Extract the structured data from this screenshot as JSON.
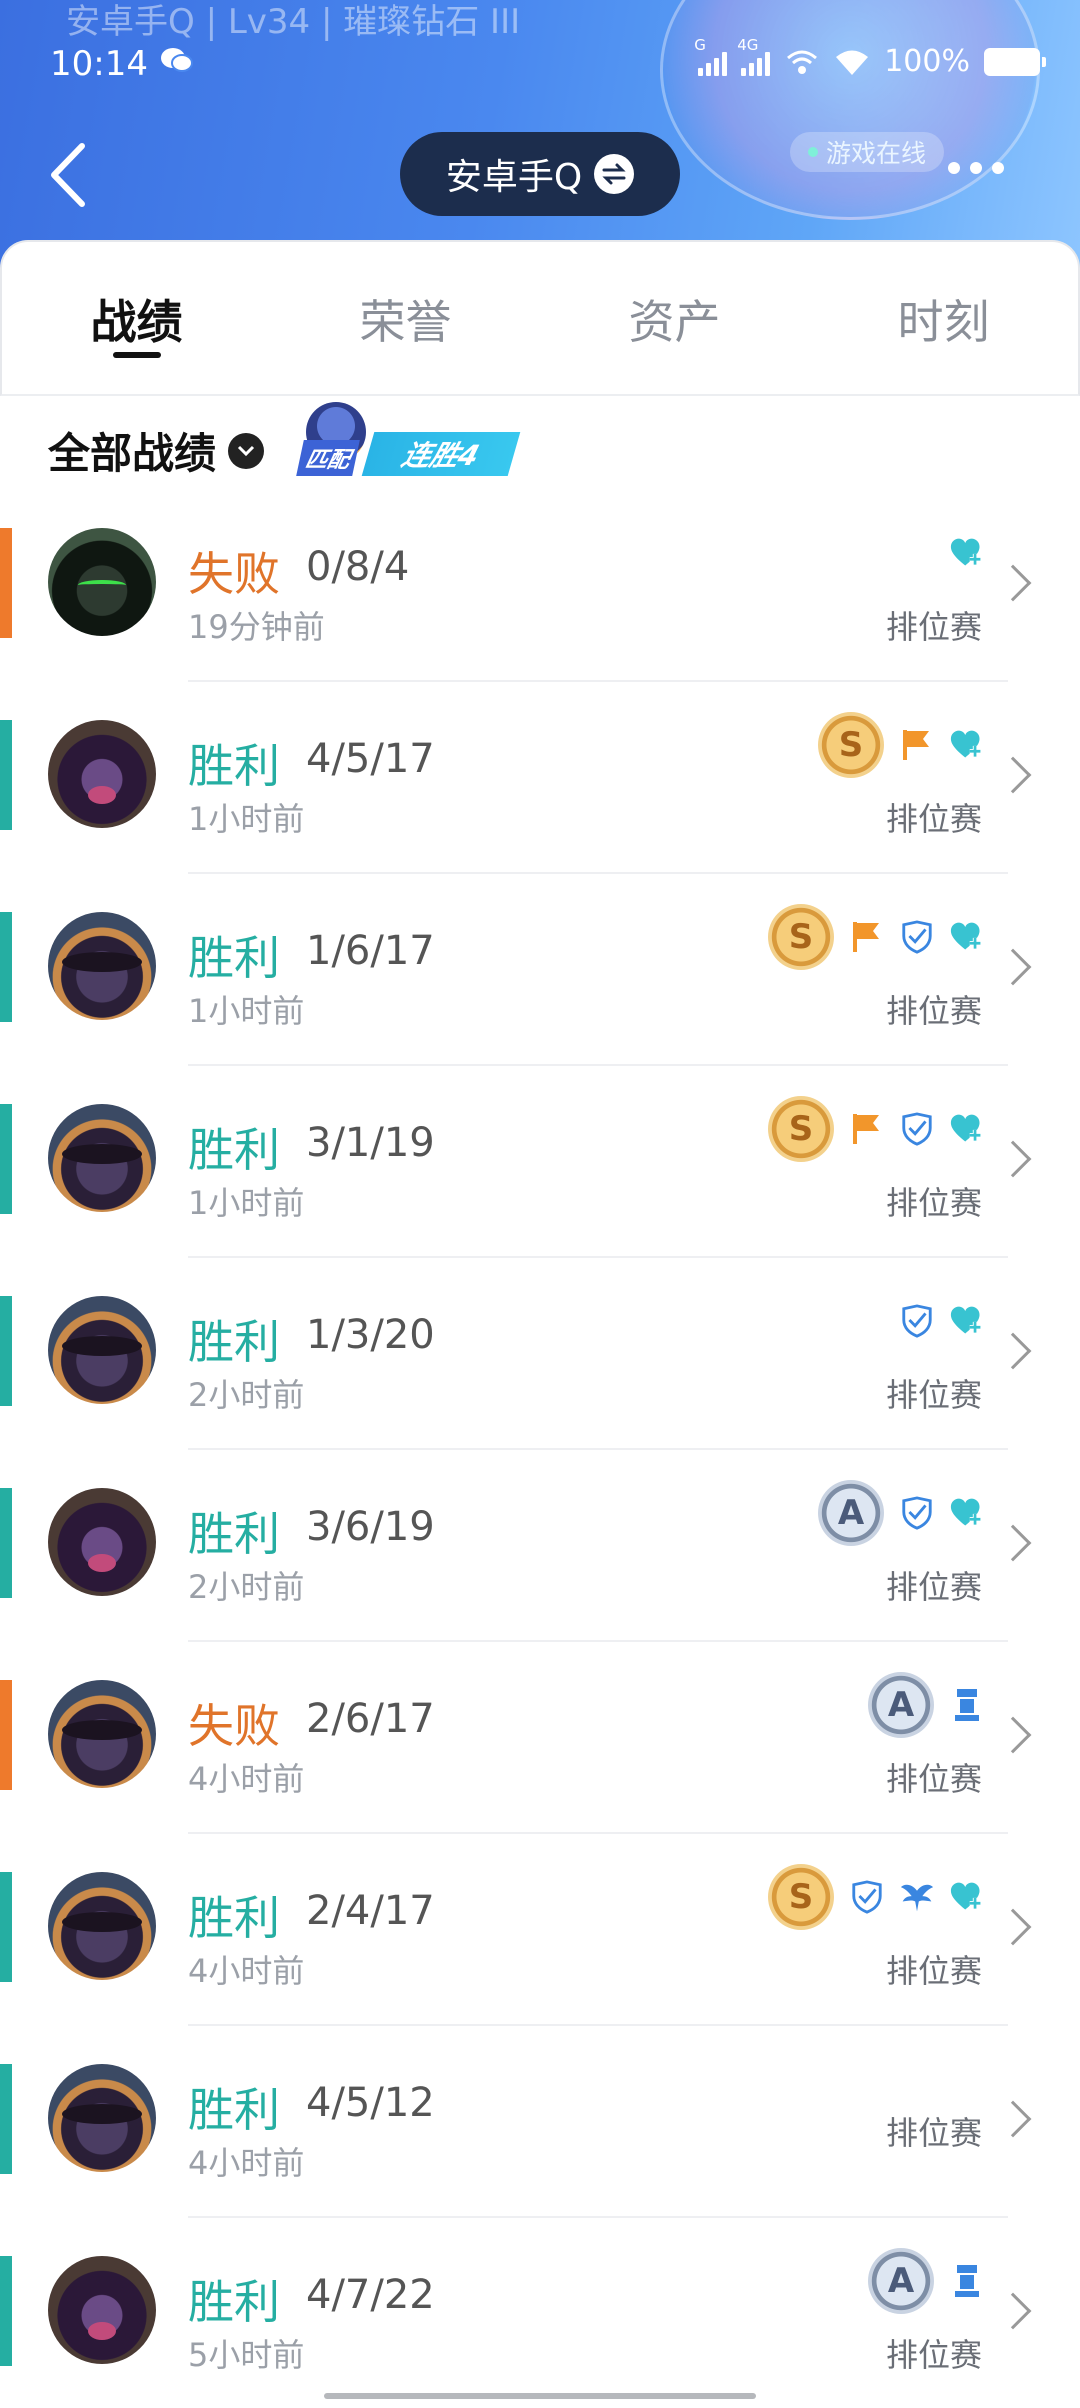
{
  "header": {
    "ghost_text": "安卓手Q | Lv34 | 璀璨钻石 III",
    "status_time": "10:14",
    "battery": "100%",
    "signal_1": "G",
    "signal_2": "4G",
    "account_name": "安卓手Q",
    "online_status": "游戏在线"
  },
  "tabs": [
    {
      "label": "战绩",
      "active": true
    },
    {
      "label": "荣誉",
      "active": false
    },
    {
      "label": "资产",
      "active": false
    },
    {
      "label": "时刻",
      "active": false
    }
  ],
  "filter": {
    "label": "全部战绩",
    "streak_tag": "匹配",
    "streak_text": "连胜4"
  },
  "matches": [
    {
      "result": "失败",
      "outcome": "loss",
      "kda": "0/8/4",
      "time": "19分钟前",
      "mode": "排位赛",
      "avatar": "a",
      "icons": [
        "heart-plus-icon"
      ]
    },
    {
      "result": "胜利",
      "outcome": "win",
      "kda": "4/5/17",
      "time": "1小时前",
      "mode": "排位赛",
      "avatar": "b",
      "icons": [
        "medal-s",
        "flag-icon",
        "heart-plus-icon"
      ]
    },
    {
      "result": "胜利",
      "outcome": "win",
      "kda": "1/6/17",
      "time": "1小时前",
      "mode": "排位赛",
      "avatar": "c",
      "icons": [
        "medal-s",
        "flag-icon",
        "shield-icon",
        "heart-plus-icon"
      ]
    },
    {
      "result": "胜利",
      "outcome": "win",
      "kda": "3/1/19",
      "time": "1小时前",
      "mode": "排位赛",
      "avatar": "c",
      "icons": [
        "medal-s",
        "flag-icon",
        "shield-icon",
        "heart-plus-icon"
      ]
    },
    {
      "result": "胜利",
      "outcome": "win",
      "kda": "1/3/20",
      "time": "2小时前",
      "mode": "排位赛",
      "avatar": "c",
      "icons": [
        "shield-icon",
        "heart-plus-icon"
      ]
    },
    {
      "result": "胜利",
      "outcome": "win",
      "kda": "3/6/19",
      "time": "2小时前",
      "mode": "排位赛",
      "avatar": "b",
      "icons": [
        "medal-a",
        "shield-icon",
        "heart-plus-icon"
      ]
    },
    {
      "result": "失败",
      "outcome": "loss",
      "kda": "2/6/17",
      "time": "4小时前",
      "mode": "排位赛",
      "avatar": "c",
      "icons": [
        "medal-a",
        "tower-icon"
      ]
    },
    {
      "result": "胜利",
      "outcome": "win",
      "kda": "2/4/17",
      "time": "4小时前",
      "mode": "排位赛",
      "avatar": "c",
      "icons": [
        "medal-s",
        "shield-icon",
        "wings-icon",
        "heart-plus-icon"
      ]
    },
    {
      "result": "胜利",
      "outcome": "win",
      "kda": "4/5/12",
      "time": "4小时前",
      "mode": "排位赛",
      "avatar": "c",
      "icons": []
    },
    {
      "result": "胜利",
      "outcome": "win",
      "kda": "4/7/22",
      "time": "5小时前",
      "mode": "排位赛",
      "avatar": "b",
      "icons": [
        "medal-a",
        "tower-icon"
      ]
    }
  ],
  "colors": {
    "win": "#25aea2",
    "loss": "#e0742a",
    "icon_teal": "#38c3d1",
    "icon_orange": "#f2962b",
    "icon_blue": "#3a86e0"
  }
}
